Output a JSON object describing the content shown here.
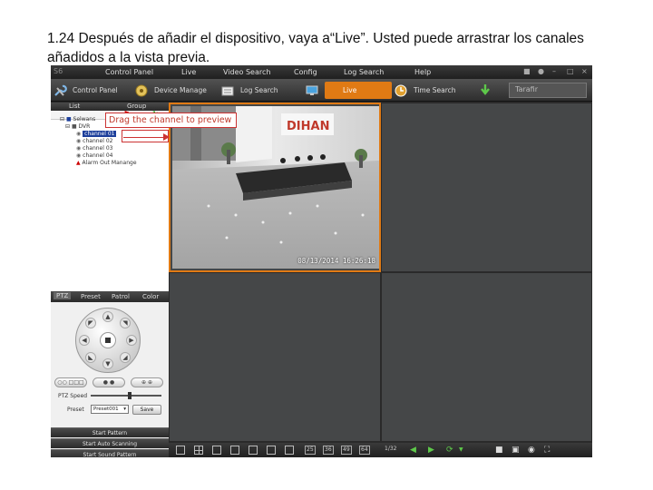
{
  "caption": {
    "line1": "1.24 Después de añadir el dispositivo, vaya a“Live”. Usted puede arrastrar los canales",
    "line2": "añadidos a la vista previa."
  },
  "menubar": {
    "items": [
      "Control Panel",
      "Live",
      "Video Search",
      "Config",
      "Log Search",
      "Help"
    ]
  },
  "toolbar": {
    "items": [
      {
        "label": "Control Panel",
        "icon": "wrench-icon"
      },
      {
        "label": "Device Manage",
        "icon": "device-icon"
      },
      {
        "label": "Log Search",
        "icon": "log-icon"
      },
      {
        "label": "Live",
        "icon": "monitor-icon",
        "active": true
      },
      {
        "label": "Time Search",
        "icon": "clock-icon"
      }
    ],
    "add_label": "Tarafir"
  },
  "left_panel": {
    "tabs": [
      "List",
      "Group"
    ],
    "tree": {
      "root": "Selwans",
      "device": "DVR",
      "channels": [
        "channel 01",
        "channel 02",
        "channel 03",
        "channel 04"
      ],
      "alarm": "Alarm Out Manange"
    }
  },
  "annotation": {
    "text": "Drag the channel to preview"
  },
  "ptz": {
    "tabs": [
      "PTZ",
      "Preset",
      "Patrol",
      "Color"
    ],
    "speed_label": "PTZ Speed",
    "speed_value": 0.55,
    "preset_label": "Preset",
    "preset_value": "Preset001",
    "save_label": "Save",
    "buttons": [
      "Start Pattern",
      "Start Auto Scanning",
      "Start Sound Pattern"
    ]
  },
  "video": {
    "brand": "DIHAN",
    "timestamp": "08/13/2014 16:26:18"
  },
  "bottombar": {
    "split_numbers": [
      "25",
      "36",
      "49",
      "64"
    ],
    "page": "1/32"
  },
  "colors": {
    "accent": "#e07a14",
    "selected_tree": "#1d3f9b",
    "annotation": "#c0392b"
  }
}
